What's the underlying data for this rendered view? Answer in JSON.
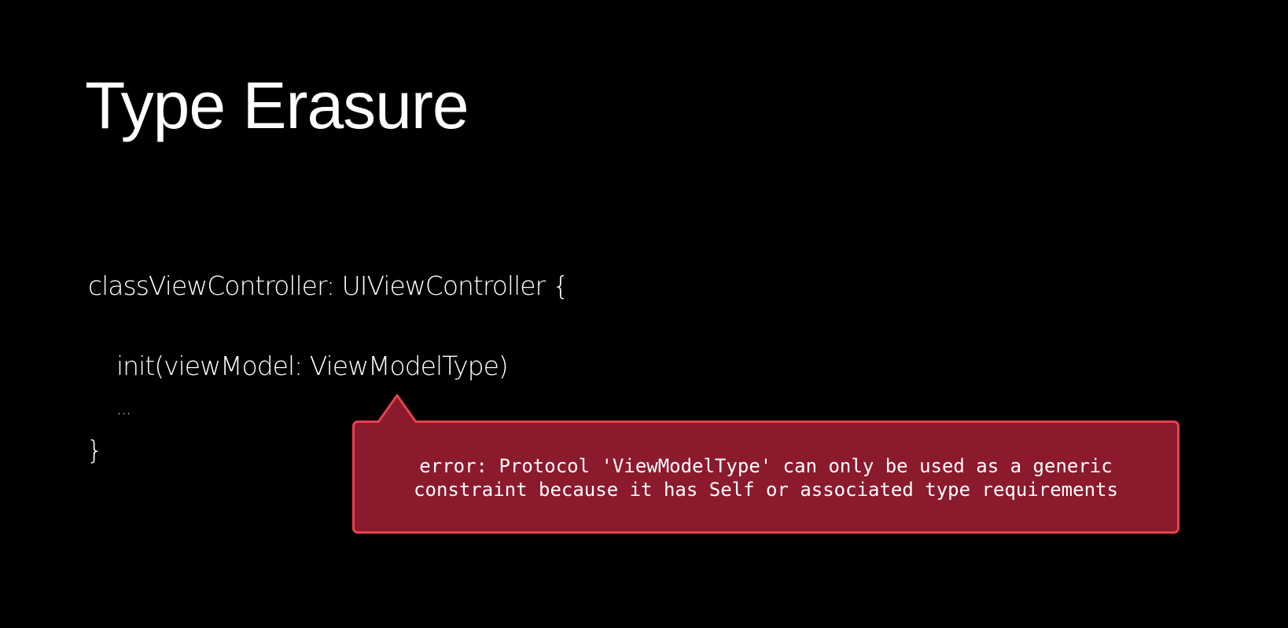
{
  "slide": {
    "title": "Type Erasure",
    "code": {
      "line_1": "classViewController: UIViewController {",
      "line_2": "init(viewModel: ViewModelType)",
      "line_3": "...",
      "line_4": "}"
    },
    "error_callout": {
      "line_1": "error: Protocol 'ViewModelType' can only be used as a generic",
      "line_2": "constraint because it has Self or associated type requirements",
      "fill_color": "#8b1a2d",
      "border_color": "#e8414f"
    },
    "background_color": "#000000"
  }
}
